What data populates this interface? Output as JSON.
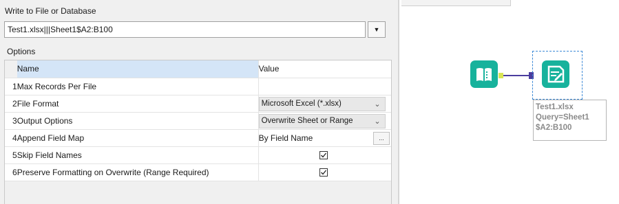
{
  "config": {
    "section_title": "Write to File or Database",
    "path_value": "Test1.xlsx|||Sheet1$A2:B100",
    "options_title": "Options",
    "columns": {
      "name": "Name",
      "value": "Value"
    },
    "rows": [
      {
        "num": "1",
        "name": "Max Records Per File",
        "value": ""
      },
      {
        "num": "2",
        "name": "File Format",
        "value": "Microsoft Excel (*.xlsx)"
      },
      {
        "num": "3",
        "name": "Output Options",
        "value": "Overwrite Sheet or Range"
      },
      {
        "num": "4",
        "name": "Append Field Map",
        "value": "By Field Name",
        "button": "..."
      },
      {
        "num": "5",
        "name": "Skip Field Names",
        "checked": true
      },
      {
        "num": "6",
        "name": "Preserve Formatting on Overwrite (Range Required)",
        "checked": true
      }
    ]
  },
  "canvas": {
    "input_tool_icon": "book-input-icon",
    "output_tool_icon": "document-output-icon",
    "annotation": [
      "Test1.xlsx",
      "Query=Sheet1",
      "$A2:B100"
    ],
    "colors": {
      "tool": "#17b29c",
      "connector": "#d9e556",
      "link": "#4a3d9e",
      "selection": "#3a88d6"
    }
  }
}
